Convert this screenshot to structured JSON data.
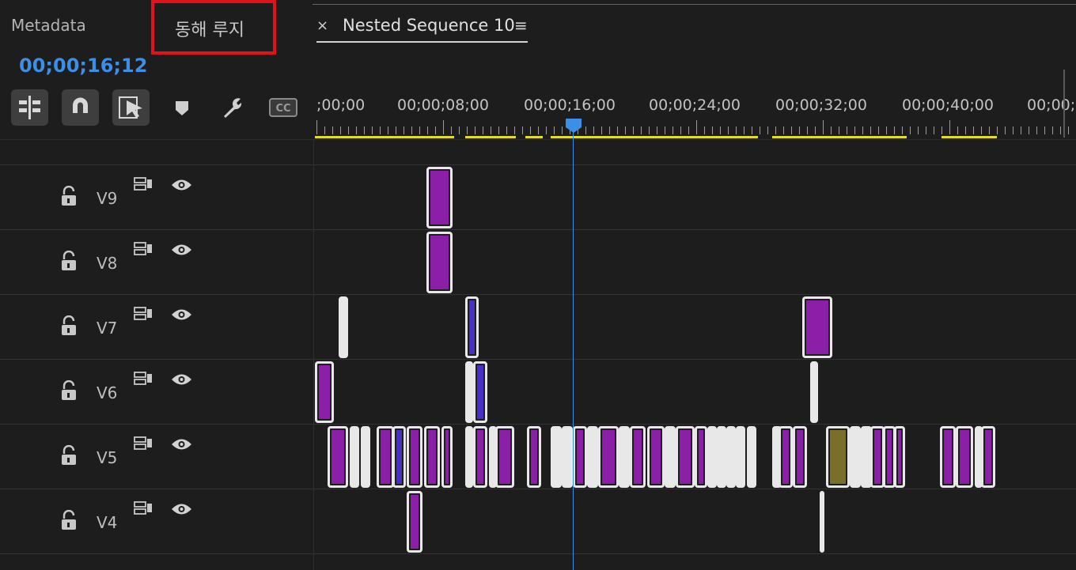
{
  "panel_tabs": {
    "metadata": "Metadata",
    "korean": "동해 루지",
    "sequence_close": "×",
    "sequence": "Nested Sequence 10",
    "sequence_menu": "≡"
  },
  "timecode": "00;00;16;12",
  "ruler_labels": [
    ";00;00",
    "00;00;08;00",
    "00;00;16;00",
    "00;00;24;00",
    "00;00;32;00",
    "00;00;40;00",
    "00;00;"
  ],
  "tools": [
    "insert-nest-icon",
    "snap-magnet-icon",
    "linked-selection-icon",
    "add-marker-icon",
    "settings-wrench-icon",
    "captions-icon"
  ],
  "captions_label": "CC",
  "tracks": [
    {
      "name": "V9"
    },
    {
      "name": "V8"
    },
    {
      "name": "V7"
    },
    {
      "name": "V6"
    },
    {
      "name": "V5"
    },
    {
      "name": "V4"
    }
  ],
  "colors": {
    "clip_purple": "#8b1fa8",
    "clip_blue": "#4a2ec9",
    "clip_olive": "#7a6f2a",
    "playhead": "#3d8fe6",
    "work_area": "#e6dd1b",
    "highlight_box": "#e3111b"
  }
}
